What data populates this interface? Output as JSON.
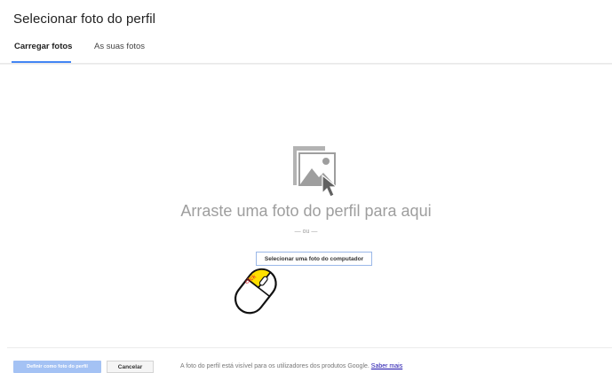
{
  "dialog": {
    "title": "Selecionar foto do perfil"
  },
  "tabs": [
    {
      "label": "Carregar fotos",
      "active": true
    },
    {
      "label": "As suas fotos",
      "active": false
    }
  ],
  "upload": {
    "drop_text": "Arraste uma foto do perfil para aqui",
    "or_text": "— ou —",
    "select_button": "Selecionar uma foto do computador",
    "cursor_label": "click"
  },
  "footer": {
    "set_button": "Definir como foto do perfil",
    "cancel_button": "Cancelar",
    "note": "A foto do perfil está visível para os utilizadores dos produtos Google.",
    "link": "Saber mais"
  },
  "colors": {
    "accent": "#4285f4",
    "primary_disabled": "#a4c2f4",
    "link": "#1a0dab",
    "cursor_highlight": "#ffe000"
  },
  "icons": [
    "image-upload-icon",
    "mouse-click-icon"
  ]
}
